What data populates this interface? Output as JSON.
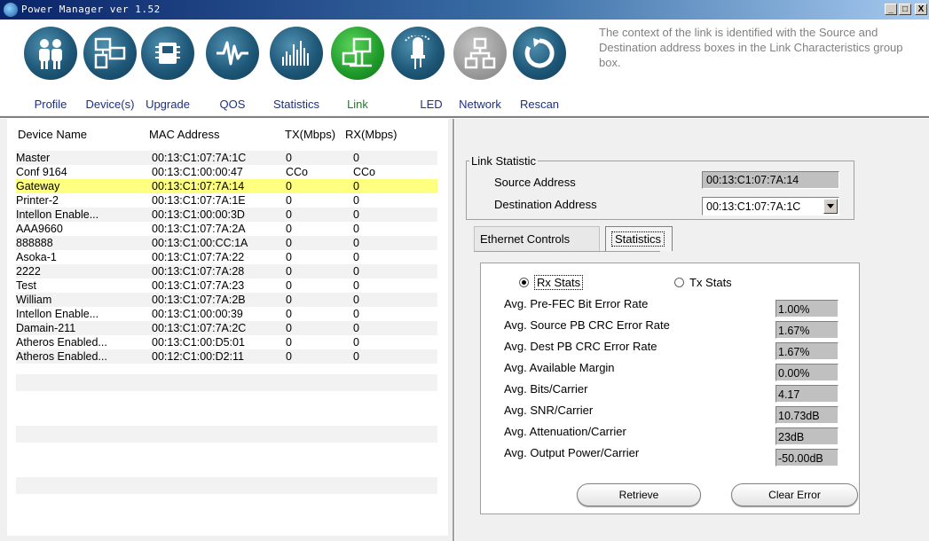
{
  "window": {
    "title": "Power Manager ver 1.52",
    "buttons": {
      "minimize": "_",
      "maximize": "□",
      "close": "X"
    }
  },
  "toolbar": {
    "items": [
      {
        "label": "Profile",
        "icon": "people-icon",
        "state": "normal"
      },
      {
        "label": "Device(s)",
        "icon": "computers-icon",
        "state": "normal"
      },
      {
        "label": "Upgrade",
        "icon": "upgrade-chip-icon",
        "state": "normal"
      },
      {
        "label": "QOS",
        "icon": "waveform-icon",
        "state": "normal"
      },
      {
        "label": "Statistics",
        "icon": "bars-icon",
        "state": "normal"
      },
      {
        "label": "Link",
        "icon": "link-network-icon",
        "state": "active"
      },
      {
        "label": "LED",
        "icon": "led-bulb-icon",
        "state": "normal"
      },
      {
        "label": "Network",
        "icon": "network-icon",
        "state": "disabled"
      },
      {
        "label": "Rescan",
        "icon": "rescan-icon",
        "state": "normal"
      }
    ],
    "description": "The context of the link is identified with the Source and Destination address boxes in the Link Characteristics group box."
  },
  "device_list": {
    "columns": [
      "Device Name",
      "MAC Address",
      "TX(Mbps)",
      "RX(Mbps)"
    ],
    "rows": [
      {
        "name": "Master",
        "mac": "00:13:C1:07:7A:1C",
        "tx": "0",
        "rx": "0"
      },
      {
        "name": "Conf 9164",
        "mac": "00:13:C1:00:00:47",
        "tx": "CCo",
        "rx": "CCo"
      },
      {
        "name": "Gateway",
        "mac": "00:13:C1:07:7A:14",
        "tx": "0",
        "rx": "0",
        "selected": true
      },
      {
        "name": "Printer-2",
        "mac": "00:13:C1:07:7A:1E",
        "tx": "0",
        "rx": "0"
      },
      {
        "name": "Intellon Enable...",
        "mac": "00:13:C1:00:00:3D",
        "tx": "0",
        "rx": "0"
      },
      {
        "name": "AAA9660",
        "mac": "00:13:C1:07:7A:2A",
        "tx": "0",
        "rx": "0"
      },
      {
        "name": "888888",
        "mac": "00:13:C1:00:CC:1A",
        "tx": "0",
        "rx": "0"
      },
      {
        "name": "Asoka-1",
        "mac": "00:13:C1:07:7A:22",
        "tx": "0",
        "rx": "0"
      },
      {
        "name": "2222",
        "mac": "00:13:C1:07:7A:28",
        "tx": "0",
        "rx": "0"
      },
      {
        "name": "Test",
        "mac": "00:13:C1:07:7A:23",
        "tx": "0",
        "rx": "0"
      },
      {
        "name": "William",
        "mac": "00:13:C1:07:7A:2B",
        "tx": "0",
        "rx": "0"
      },
      {
        "name": "Intellon Enable...",
        "mac": "00:13:C1:00:00:39",
        "tx": "0",
        "rx": "0"
      },
      {
        "name": "Damain-211",
        "mac": "00:13:C1:07:7A:2C",
        "tx": "0",
        "rx": "0"
      },
      {
        "name": "Atheros Enabled...",
        "mac": "00:13:C1:00:D5:01",
        "tx": "0",
        "rx": "0"
      },
      {
        "name": "Atheros Enabled...",
        "mac": "00:12:C1:00:D2:11",
        "tx": "0",
        "rx": "0"
      }
    ]
  },
  "link_statistic": {
    "group_title": "Link Statistic",
    "source_label": "Source Address",
    "source_value": "00:13:C1:07:7A:14",
    "destination_label": "Destination Address",
    "destination_value": "00:13:C1:07:7A:1C"
  },
  "tabs": [
    {
      "label": "Ethernet Controls",
      "active": false
    },
    {
      "label": "Statistics",
      "active": true
    }
  ],
  "stats": {
    "rx_label": "Rx Stats",
    "tx_label": "Tx Stats",
    "selected_mode": "rx",
    "items": [
      {
        "label": "Avg. Pre-FEC Bit Error Rate",
        "value": "1.00%"
      },
      {
        "label": "Avg. Source PB CRC Error Rate",
        "value": "1.67%"
      },
      {
        "label": "Avg. Dest PB CRC Error Rate",
        "value": "1.67%"
      },
      {
        "label": "Avg. Available Margin",
        "value": "0.00%"
      },
      {
        "label": "Avg. Bits/Carrier",
        "value": "4.17"
      },
      {
        "label": "Avg. SNR/Carrier",
        "value": "10.73dB"
      },
      {
        "label": "Avg. Attenuation/Carrier",
        "value": "23dB"
      },
      {
        "label": "Avg. Output Power/Carrier",
        "value": "-50.00dB"
      }
    ],
    "retrieve_label": "Retrieve",
    "clear_label": "Clear Error"
  },
  "colors": {
    "title_bar": "#0a246a",
    "selected_row": "#ffff80",
    "toolbar_label": "#1a2f8a",
    "active_label": "#1f7a2a",
    "description_text": "#808080"
  }
}
